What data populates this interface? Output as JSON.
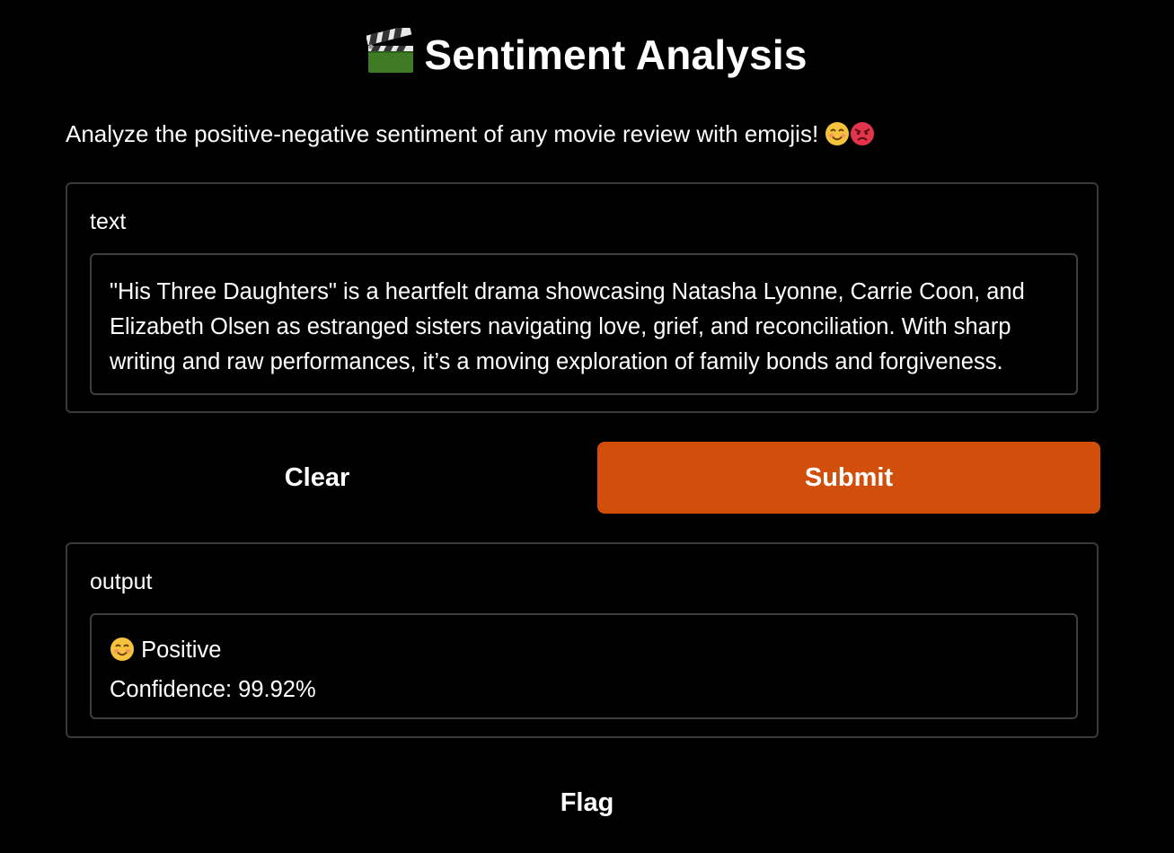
{
  "app": {
    "title": "Sentiment Analysis",
    "title_icon": "clapperboard-icon",
    "description": "Analyze the positive-negative sentiment of any movie review with emojis!",
    "description_icons": [
      "smiling-face-icon",
      "angry-face-icon"
    ]
  },
  "input": {
    "label": "text",
    "value": "\"His Three Daughters\" is a heartfelt drama showcasing Natasha Lyonne, Carrie Coon, and Elizabeth Olsen as estranged sisters navigating love, grief, and reconciliation. With sharp writing and raw performances, it’s a moving exploration of family bonds and forgiveness."
  },
  "buttons": {
    "clear_label": "Clear",
    "submit_label": "Submit",
    "flag_label": "Flag"
  },
  "output": {
    "label": "output",
    "sentiment_icon": "smiling-face-icon",
    "sentiment": "Positive",
    "confidence": "Confidence: 99.92%"
  },
  "colors": {
    "background": "#000000",
    "accent": "#d24f0b",
    "border": "#3a3a3a",
    "text": "#ffffff"
  }
}
